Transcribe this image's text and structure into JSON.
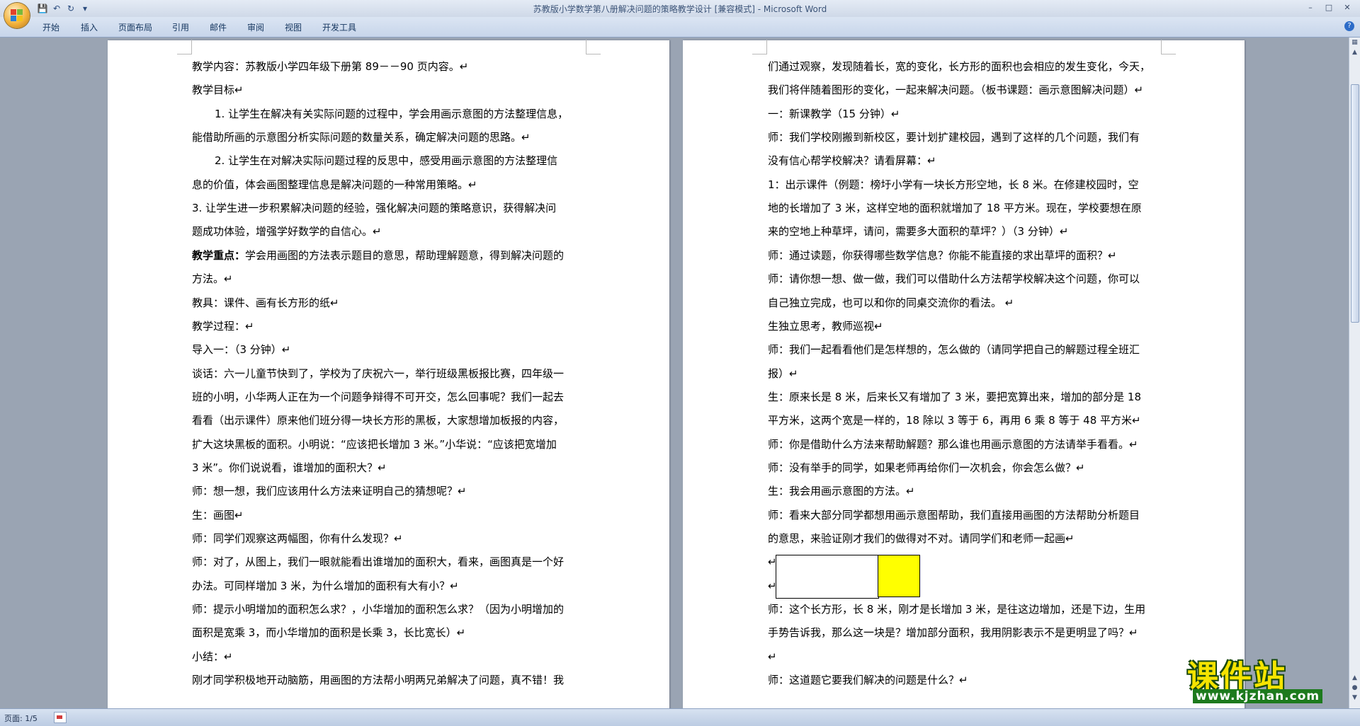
{
  "window": {
    "title_doc": "苏教版小学数学第八册解决问题的策略教学设计 [兼容模式] - ",
    "title_app": "Microsoft Word"
  },
  "qat": {
    "save_icon": "save-icon",
    "undo_icon": "undo-icon",
    "redo_icon": "redo-icon",
    "customize_icon": "customize-qat-icon"
  },
  "ribbon": {
    "tabs": [
      "开始",
      "插入",
      "页面布局",
      "引用",
      "邮件",
      "审阅",
      "视图",
      "开发工具"
    ]
  },
  "page1": {
    "lines": [
      "教学内容：苏教版小学四年级下册第 89－－90 页内容。↵",
      "教学目标↵",
      "1. 让学生在解决有关实际问题的过程中，学会用画示意图的方法整理信息，",
      "能借助所画的示意图分析实际问题的数量关系，确定解决问题的思路。↵",
      "2. 让学生在对解决实际问题过程的反思中，感受用画示意图的方法整理信",
      "息的价值，体会画图整理信息是解决问题的一种常用策略。↵",
      "3. 让学生进一步积累解决问题的经验，强化解决问题的策略意识，获得解决问",
      "题成功体验，增强学好数学的自信心。↵",
      "教学重点：|学会用画图的方法表示题目的意思，帮助理解题意，得到解决问题的",
      "方法。↵",
      "教具：课件、画有长方形的纸↵",
      "教学过程：↵",
      "导入一：（3 分钟）↵",
      "谈话：六一儿童节快到了，学校为了庆祝六一，举行班级黑板报比赛，四年级一",
      "班的小明，小华两人正在为一个问题争辩得不可开交，怎么回事呢？我们一起去",
      "看看（出示课件）原来他们班分得一块长方形的黑板，大家想增加板报的内容，",
      "扩大这块黑板的面积。小明说：“应该把长增加 3 米。”小华说：“应该把宽增加",
      "3 米”。你们说说看，谁增加的面积大？↵",
      "师：想一想，我们应该用什么方法来证明自己的猜想呢？↵",
      "生：画图↵",
      "师：同学们观察这两幅图，你有什么发现？↵",
      "师：对了，从图上，我们一眼就能看出谁增加的面积大，看来，画图真是一个好",
      "办法。可同样增加 3 米，为什么增加的面积有大有小？↵",
      "师：提示小明增加的面积怎么求？，小华增加的面积怎么求？（因为小明增加的",
      "面积是宽乘 3，而小华增加的面积是长乘 3，长比宽长）↵",
      "小结：↵",
      "刚才同学积极地开动脑筋，用画图的方法帮小明两兄弟解决了问题，真不错！我"
    ]
  },
  "page2": {
    "lines": [
      "们通过观察，发现随着长，宽的变化，长方形的面积也会相应的发生变化，今天，",
      "我们将伴随着图形的变化，一起来解决问题。（板书课题：画示意图解决问题）↵",
      "一：新课教学（15 分钟）↵",
      "师：我们学校刚搬到新校区，要计划扩建校园，遇到了这样的几个问题，我们有",
      "没有信心帮学校解决？请看屏幕：↵",
      "1：出示课件（例题：榜圩小学有一块长方形空地，长 8 米。在修建校园时，空",
      "地的长增加了 3 米，这样空地的面积就增加了 18 平方米。现在，学校要想在原",
      "来的空地上种草坪，请问，需要多大面积的草坪？）（3 分钟）↵",
      "师：通过读题，你获得哪些数学信息？你能不能直接的求出草坪的面积？↵",
      "师：请你想一想、做一做，我们可以借助什么方法帮学校解决这个问题，你可以",
      "自己独立完成，也可以和你的同桌交流你的看法。 ↵",
      "生独立思考，教师巡视↵",
      "师：我们一起看看他们是怎样想的，怎么做的（请同学把自己的解题过程全班汇",
      "报）↵",
      "生：原来长是 8 米，后来长又有增加了 3 米，要把宽算出来，增加的部分是 18",
      "平方米，这两个宽是一样的，18 除以 3 等于 6，再用 6 乘 8 等于 48 平方米↵",
      "师：你是借助什么方法来帮助解题？那么谁也用画示意图的方法请举手看看。↵",
      "师：没有举手的同学，如果老师再给你们一次机会，你会怎么做？↵",
      "生：我会用画示意图的方法。↵",
      "师：看来大部分同学都想用画示意图帮助，我们直接用画图的方法帮助分析题目",
      "的意思，来验证刚才我们的做得对不对。请同学们和老师一起画↵",
      "↵",
      "↵",
      "师：这个长方形，长 8 米，刚才是长增加 3 米，是往这边增加，还是下边，生用",
      "手势告诉我，那么这一块是？增加部分面积，我用阴影表示不是更明显了吗？↵",
      "↵",
      "师：这道题它要我们解决的问题是什么？↵"
    ]
  },
  "status": {
    "page": "页面: 1/5"
  },
  "watermark": {
    "title": "课件站",
    "url": "www.kjzhan.com"
  }
}
